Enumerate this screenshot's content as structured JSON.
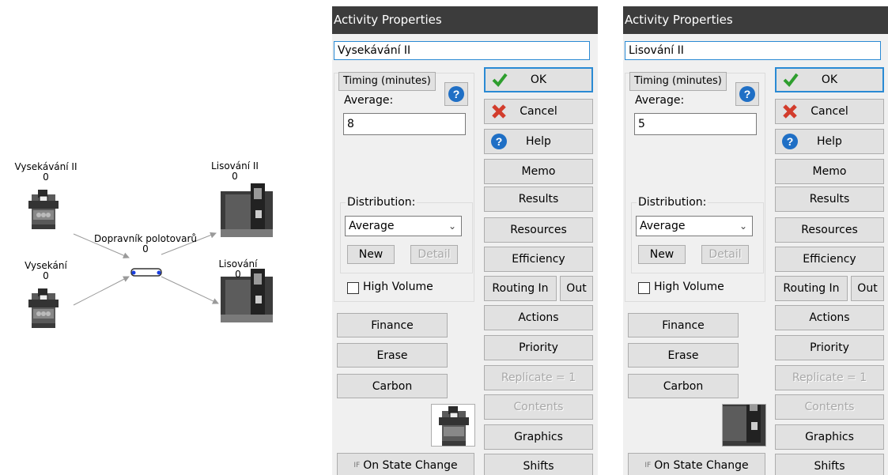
{
  "diagram": {
    "nodes": [
      {
        "label": "Vysekávání II",
        "count": "0"
      },
      {
        "label": "Lisování II",
        "count": "0"
      },
      {
        "label": "Dopravník polotovarů",
        "count": "0"
      },
      {
        "label": "Vysekání",
        "count": "0"
      },
      {
        "label": "Lisování",
        "count": "0"
      }
    ]
  },
  "dialogs": [
    {
      "title": "Activity Properties",
      "name": "Vysekávání II",
      "timing_label": "Timing (minutes)",
      "average_label": "Average:",
      "average_value": "8",
      "distribution_label": "Distribution:",
      "distribution_value": "Average",
      "new_label": "New",
      "detail_label": "Detail",
      "high_volume_label": "High Volume",
      "finance_label": "Finance",
      "erase_label": "Erase",
      "carbon_label": "Carbon",
      "state_change_label": "On State Change",
      "if_badge": "IF",
      "buttons": {
        "ok": "OK",
        "cancel": "Cancel",
        "help": "Help",
        "memo": "Memo",
        "results": "Results",
        "resources": "Resources",
        "efficiency": "Efficiency",
        "routing_in": "Routing In",
        "out": "Out",
        "actions": "Actions",
        "priority": "Priority",
        "replicate": "Replicate = 1",
        "contents": "Contents",
        "graphics": "Graphics",
        "shifts": "Shifts"
      }
    },
    {
      "title": "Activity Properties",
      "name": "Lisování II",
      "timing_label": "Timing (minutes)",
      "average_label": "Average:",
      "average_value": "5",
      "distribution_label": "Distribution:",
      "distribution_value": "Average",
      "new_label": "New",
      "detail_label": "Detail",
      "high_volume_label": "High Volume",
      "finance_label": "Finance",
      "erase_label": "Erase",
      "carbon_label": "Carbon",
      "state_change_label": "On State Change",
      "if_badge": "IF",
      "buttons": {
        "ok": "OK",
        "cancel": "Cancel",
        "help": "Help",
        "memo": "Memo",
        "results": "Results",
        "resources": "Resources",
        "efficiency": "Efficiency",
        "routing_in": "Routing In",
        "out": "Out",
        "actions": "Actions",
        "priority": "Priority",
        "replicate": "Replicate = 1",
        "contents": "Contents",
        "graphics": "Graphics",
        "shifts": "Shifts"
      }
    }
  ],
  "colors": {
    "titlebar": "#3c3c3c",
    "focus": "#2a8ad4",
    "ok_check": "#2e9e2e",
    "cancel_x": "#d23c2c",
    "help_blue": "#1f6fc5"
  }
}
